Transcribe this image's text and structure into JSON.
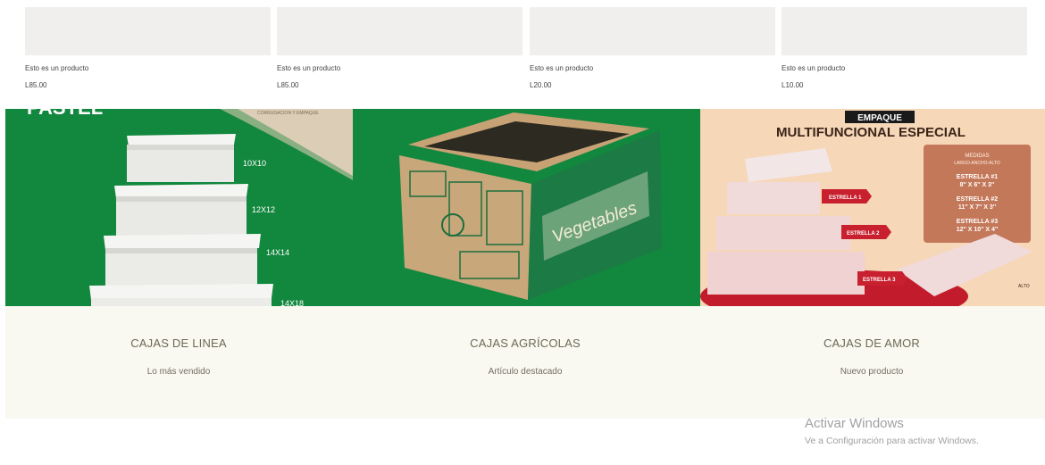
{
  "products": [
    {
      "name": "Esto es un producto",
      "price": "L85.00"
    },
    {
      "name": "Esto es un producto",
      "price": "L85.00"
    },
    {
      "name": "Esto es un producto",
      "price": "L20.00"
    },
    {
      "name": "Esto es un producto",
      "price": "L10.00"
    }
  ],
  "banner": {
    "panel1": {
      "headline": "PASTEL",
      "tagline": "CORRUGACION Y EMPAQUE",
      "sizes": [
        "10X10",
        "12X12",
        "14X14",
        "14X18"
      ]
    },
    "panel2": {
      "box_brand": "Vegetables"
    },
    "panel3": {
      "tag": "EMPAQUE",
      "title": "MULTIFUNCIONAL ESPECIAL",
      "measures_title": "MEDIDAS",
      "measures_sub": "LARGO-ANCHO-ALTO",
      "stars": [
        {
          "label": "ESTRELLA #1",
          "size": "8'' X 6'' X 3''"
        },
        {
          "label": "ESTRELLA #2",
          "size": "11'' X 7'' X 3''"
        },
        {
          "label": "ESTRELLA #3",
          "size": "12'' X 10'' X 4''"
        }
      ],
      "ribbons": [
        "ESTRELLA 1",
        "ESTRELLA 2",
        "ESTRELLA 3"
      ],
      "height_note": "ALTO"
    }
  },
  "categories": [
    {
      "title": "CAJAS DE LINEA",
      "subtitle": "Lo más vendido"
    },
    {
      "title": "CAJAS AGRÍCOLAS",
      "subtitle": "Artículo destacado"
    },
    {
      "title": "CAJAS DE AMOR",
      "subtitle": "Nuevo producto"
    }
  ],
  "activation": {
    "title": "Activar Windows",
    "subtitle": "Ve a Configuración para activar Windows."
  },
  "colors": {
    "thumb_bg": "#f1efee",
    "green": "#12873e",
    "peach": "#f6d7b8",
    "category_bg": "#f9f8f1",
    "title_text": "#6e6a56"
  }
}
